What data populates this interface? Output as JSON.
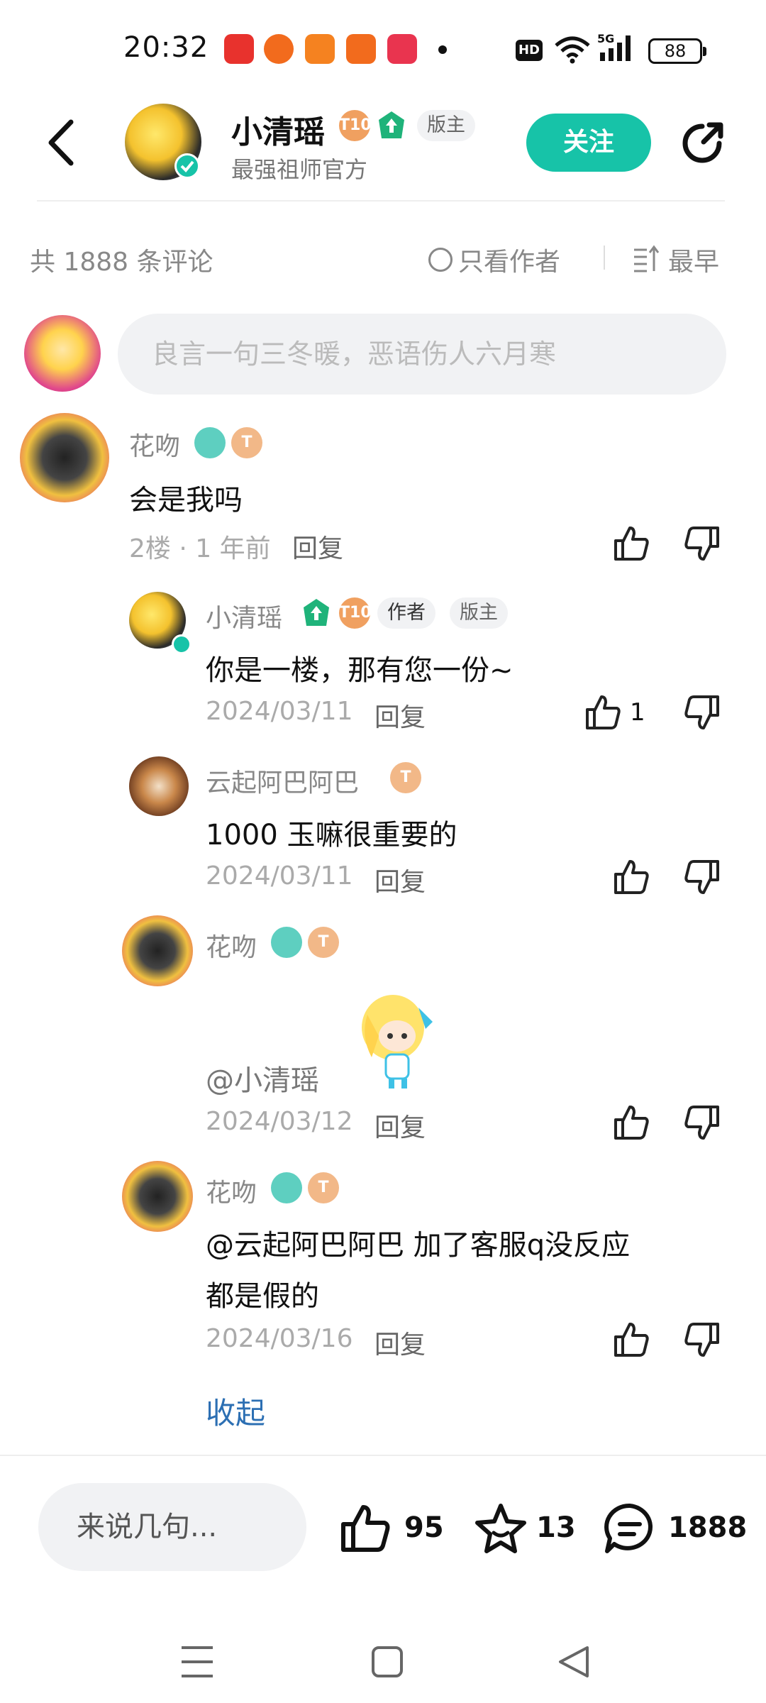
{
  "status_bar": {
    "time": "20:32",
    "hd": "HD",
    "battery": "88",
    "network": "5G"
  },
  "header": {
    "author_name": "小清瑶",
    "author_subtitle": "最强祖师官方",
    "badge_moderator": "版主",
    "follow_label": "关注",
    "level_badge": "T10"
  },
  "comments_header": {
    "count_text": "共 1888 条评论",
    "only_author_label": "只看作者",
    "sort_label": "最早"
  },
  "input": {
    "placeholder": "良言一句三冬暖，恶语伤人六月寒"
  },
  "main_comment": {
    "user": "花吻",
    "text": "会是我吗",
    "meta": "2楼 · 1 年前",
    "reply_label": "回复"
  },
  "replies": [
    {
      "user": "小清瑶",
      "tag_author": "作者",
      "tag_mod": "版主",
      "text": "你是一楼，那有您一份~",
      "date": "2024/03/11",
      "reply_label": "回复",
      "likes": "1"
    },
    {
      "user": "云起阿巴阿巴",
      "text": "1000 玉嘛很重要的",
      "date": "2024/03/11",
      "reply_label": "回复"
    },
    {
      "user": "花吻",
      "text": "@小清瑶",
      "date": "2024/03/12",
      "reply_label": "回复"
    },
    {
      "user": "花吻",
      "text_line1": "@云起阿巴阿巴  加了客服q没反应",
      "text_line2": " 都是假的",
      "date": "2024/03/16",
      "reply_label": "回复"
    }
  ],
  "collapse_label": "收起",
  "bottom_bar": {
    "input_label": "来说几句...",
    "likes": "95",
    "favorites": "13",
    "comments": "1888"
  },
  "colors": {
    "accent": "#17c3a8",
    "link": "#2c6fb3",
    "badge_orange": "#f0a060",
    "level_green": "#1fb37a"
  }
}
